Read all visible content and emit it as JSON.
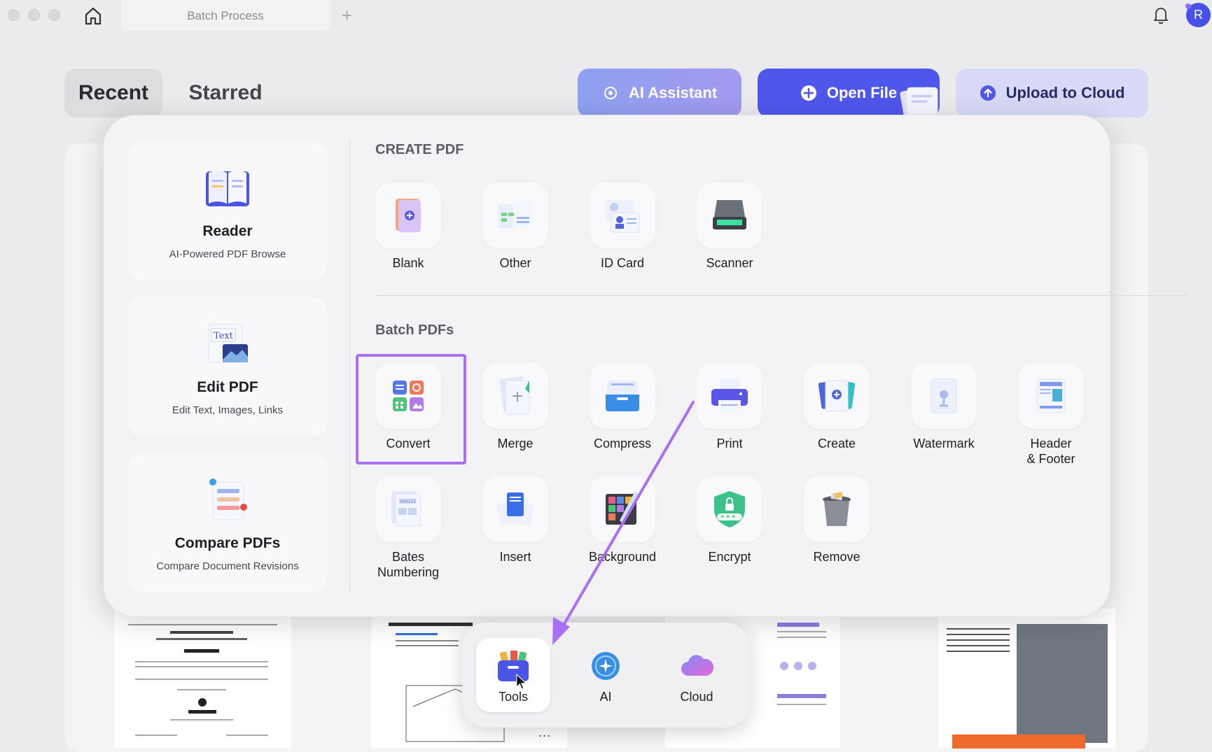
{
  "titlebar": {
    "tab_label": "Batch Process",
    "add_tab": "+",
    "avatar_initial": "R"
  },
  "header": {
    "tabs": [
      {
        "label": "Recent"
      },
      {
        "label": "Starred"
      }
    ],
    "actions": {
      "ai_label": "AI Assistant",
      "open_label": "Open File",
      "upload_label": "Upload to Cloud"
    }
  },
  "modes": [
    {
      "title": "Reader",
      "subtitle": "AI-Powered PDF Browse",
      "icon": "book-icon"
    },
    {
      "title": "Edit PDF",
      "subtitle": "Edit Text, Images, Links",
      "icon": "edit-text-icon"
    },
    {
      "title": "Compare PDFs",
      "subtitle": "Compare Document Revisions",
      "icon": "compare-icon"
    }
  ],
  "create_pdf": {
    "heading": "CREATE PDF",
    "items": [
      {
        "label": "Blank"
      },
      {
        "label": "Other"
      },
      {
        "label": "ID Card"
      },
      {
        "label": "Scanner"
      }
    ]
  },
  "batch_pdfs": {
    "heading": "Batch PDFs",
    "items": [
      {
        "label": "Convert"
      },
      {
        "label": "Merge"
      },
      {
        "label": "Compress"
      },
      {
        "label": "Print"
      },
      {
        "label": "Create"
      },
      {
        "label": "Watermark"
      },
      {
        "label": "Header\n& Footer"
      },
      {
        "label": "Bates\nNumbering"
      },
      {
        "label": "Insert"
      },
      {
        "label": "Background"
      },
      {
        "label": "Encrypt"
      },
      {
        "label": "Remove"
      }
    ],
    "selected": "Convert"
  },
  "dock": {
    "items": [
      {
        "label": "Tools"
      },
      {
        "label": "AI"
      },
      {
        "label": "Cloud"
      }
    ],
    "active": "Tools",
    "more": "..."
  },
  "colors": {
    "accent": "#4f56ec",
    "highlight": "#a970f3",
    "arrow": "#a970f3"
  }
}
